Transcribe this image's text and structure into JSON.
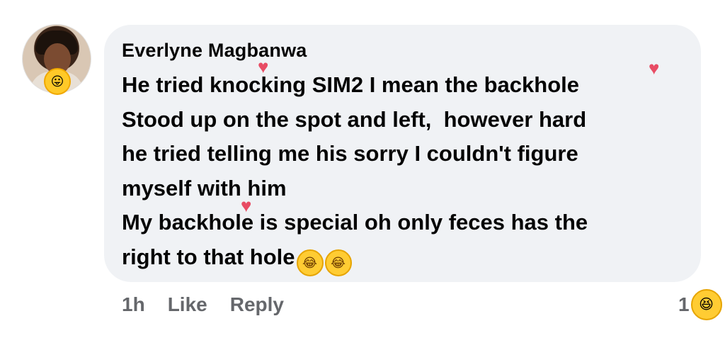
{
  "comment": {
    "author": "Everlyne Magbanwa",
    "text": "He tried knocking SIM2 I mean the backhole\nStood up on the spot and left,  however hard\nhe tried telling me his sorry I couldn't figure\nmyself with him\nMy backhole is special oh only feces has the\nright to that hole",
    "trailing_emojis": [
      "😂",
      "😂"
    ]
  },
  "actions": {
    "time": "1h",
    "like_label": "Like",
    "reply_label": "Reply"
  },
  "reaction": {
    "count": "1",
    "emoji": "😆"
  },
  "avatar_emoji": "😛",
  "stickers": [
    "♥",
    "♥",
    "♥"
  ],
  "colors": {
    "bubble": "#f0f2f5",
    "text": "#050505",
    "secondary": "#65676b",
    "heart": "#e84c64"
  }
}
